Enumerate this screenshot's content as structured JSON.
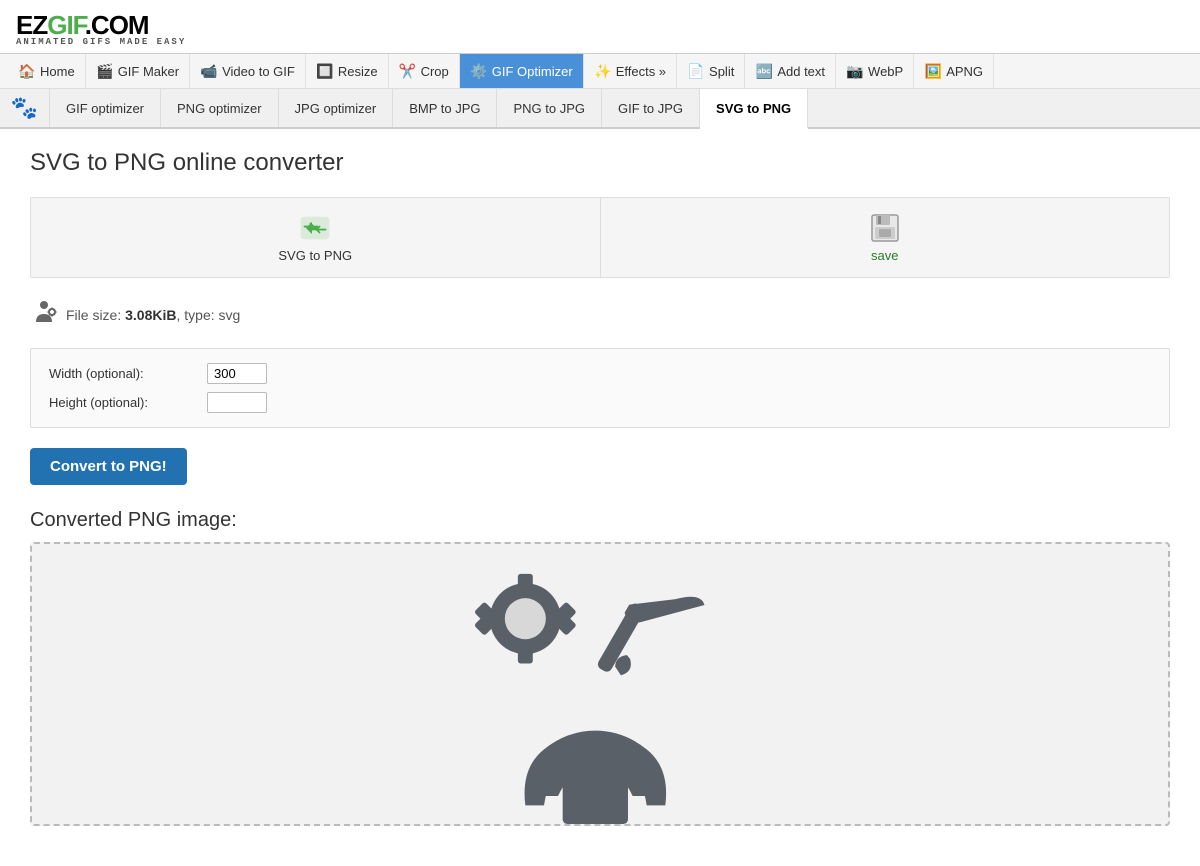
{
  "site": {
    "logo_text": "EZGIF.COM",
    "logo_sub": "ANIMATED GIFS MADE EASY"
  },
  "nav": {
    "items": [
      {
        "id": "home",
        "label": "Home",
        "icon": "🏠",
        "active": false
      },
      {
        "id": "gif-maker",
        "label": "GIF Maker",
        "icon": "🎬",
        "active": false
      },
      {
        "id": "video-to-gif",
        "label": "Video to GIF",
        "icon": "📹",
        "active": false
      },
      {
        "id": "resize",
        "label": "Resize",
        "icon": "🔲",
        "active": false
      },
      {
        "id": "crop",
        "label": "Crop",
        "icon": "✂️",
        "active": false
      },
      {
        "id": "gif-optimizer",
        "label": "GIF Optimizer",
        "icon": "⚙️",
        "active": true
      },
      {
        "id": "effects",
        "label": "Effects »",
        "icon": "✨",
        "active": false
      },
      {
        "id": "split",
        "label": "Split",
        "icon": "📄",
        "active": false
      },
      {
        "id": "add-text",
        "label": "Add text",
        "icon": "🔤",
        "active": false
      },
      {
        "id": "webp",
        "label": "WebP",
        "icon": "📷",
        "active": false
      },
      {
        "id": "apng",
        "label": "APNG",
        "icon": "🖼️",
        "active": false
      }
    ]
  },
  "subnav": {
    "items": [
      {
        "id": "gif-optimizer",
        "label": "GIF optimizer",
        "active": false
      },
      {
        "id": "png-optimizer",
        "label": "PNG optimizer",
        "active": false
      },
      {
        "id": "jpg-optimizer",
        "label": "JPG optimizer",
        "active": false
      },
      {
        "id": "bmp-to-jpg",
        "label": "BMP to JPG",
        "active": false
      },
      {
        "id": "png-to-jpg",
        "label": "PNG to JPG",
        "active": false
      },
      {
        "id": "gif-to-jpg",
        "label": "GIF to JPG",
        "active": false
      },
      {
        "id": "svg-to-png",
        "label": "SVG to PNG",
        "active": true
      }
    ]
  },
  "page": {
    "title": "SVG to PNG online converter",
    "action_upload_label": "SVG to PNG",
    "action_save_label": "save",
    "file_size": "3.08KiB",
    "file_type": "svg",
    "file_size_prefix": "File size: ",
    "file_type_prefix": ", type: ",
    "width_label": "Width (optional):",
    "height_label": "Height (optional):",
    "width_value": "300",
    "height_value": "",
    "convert_btn_label": "Convert to PNG!",
    "result_title": "Converted PNG image:"
  }
}
